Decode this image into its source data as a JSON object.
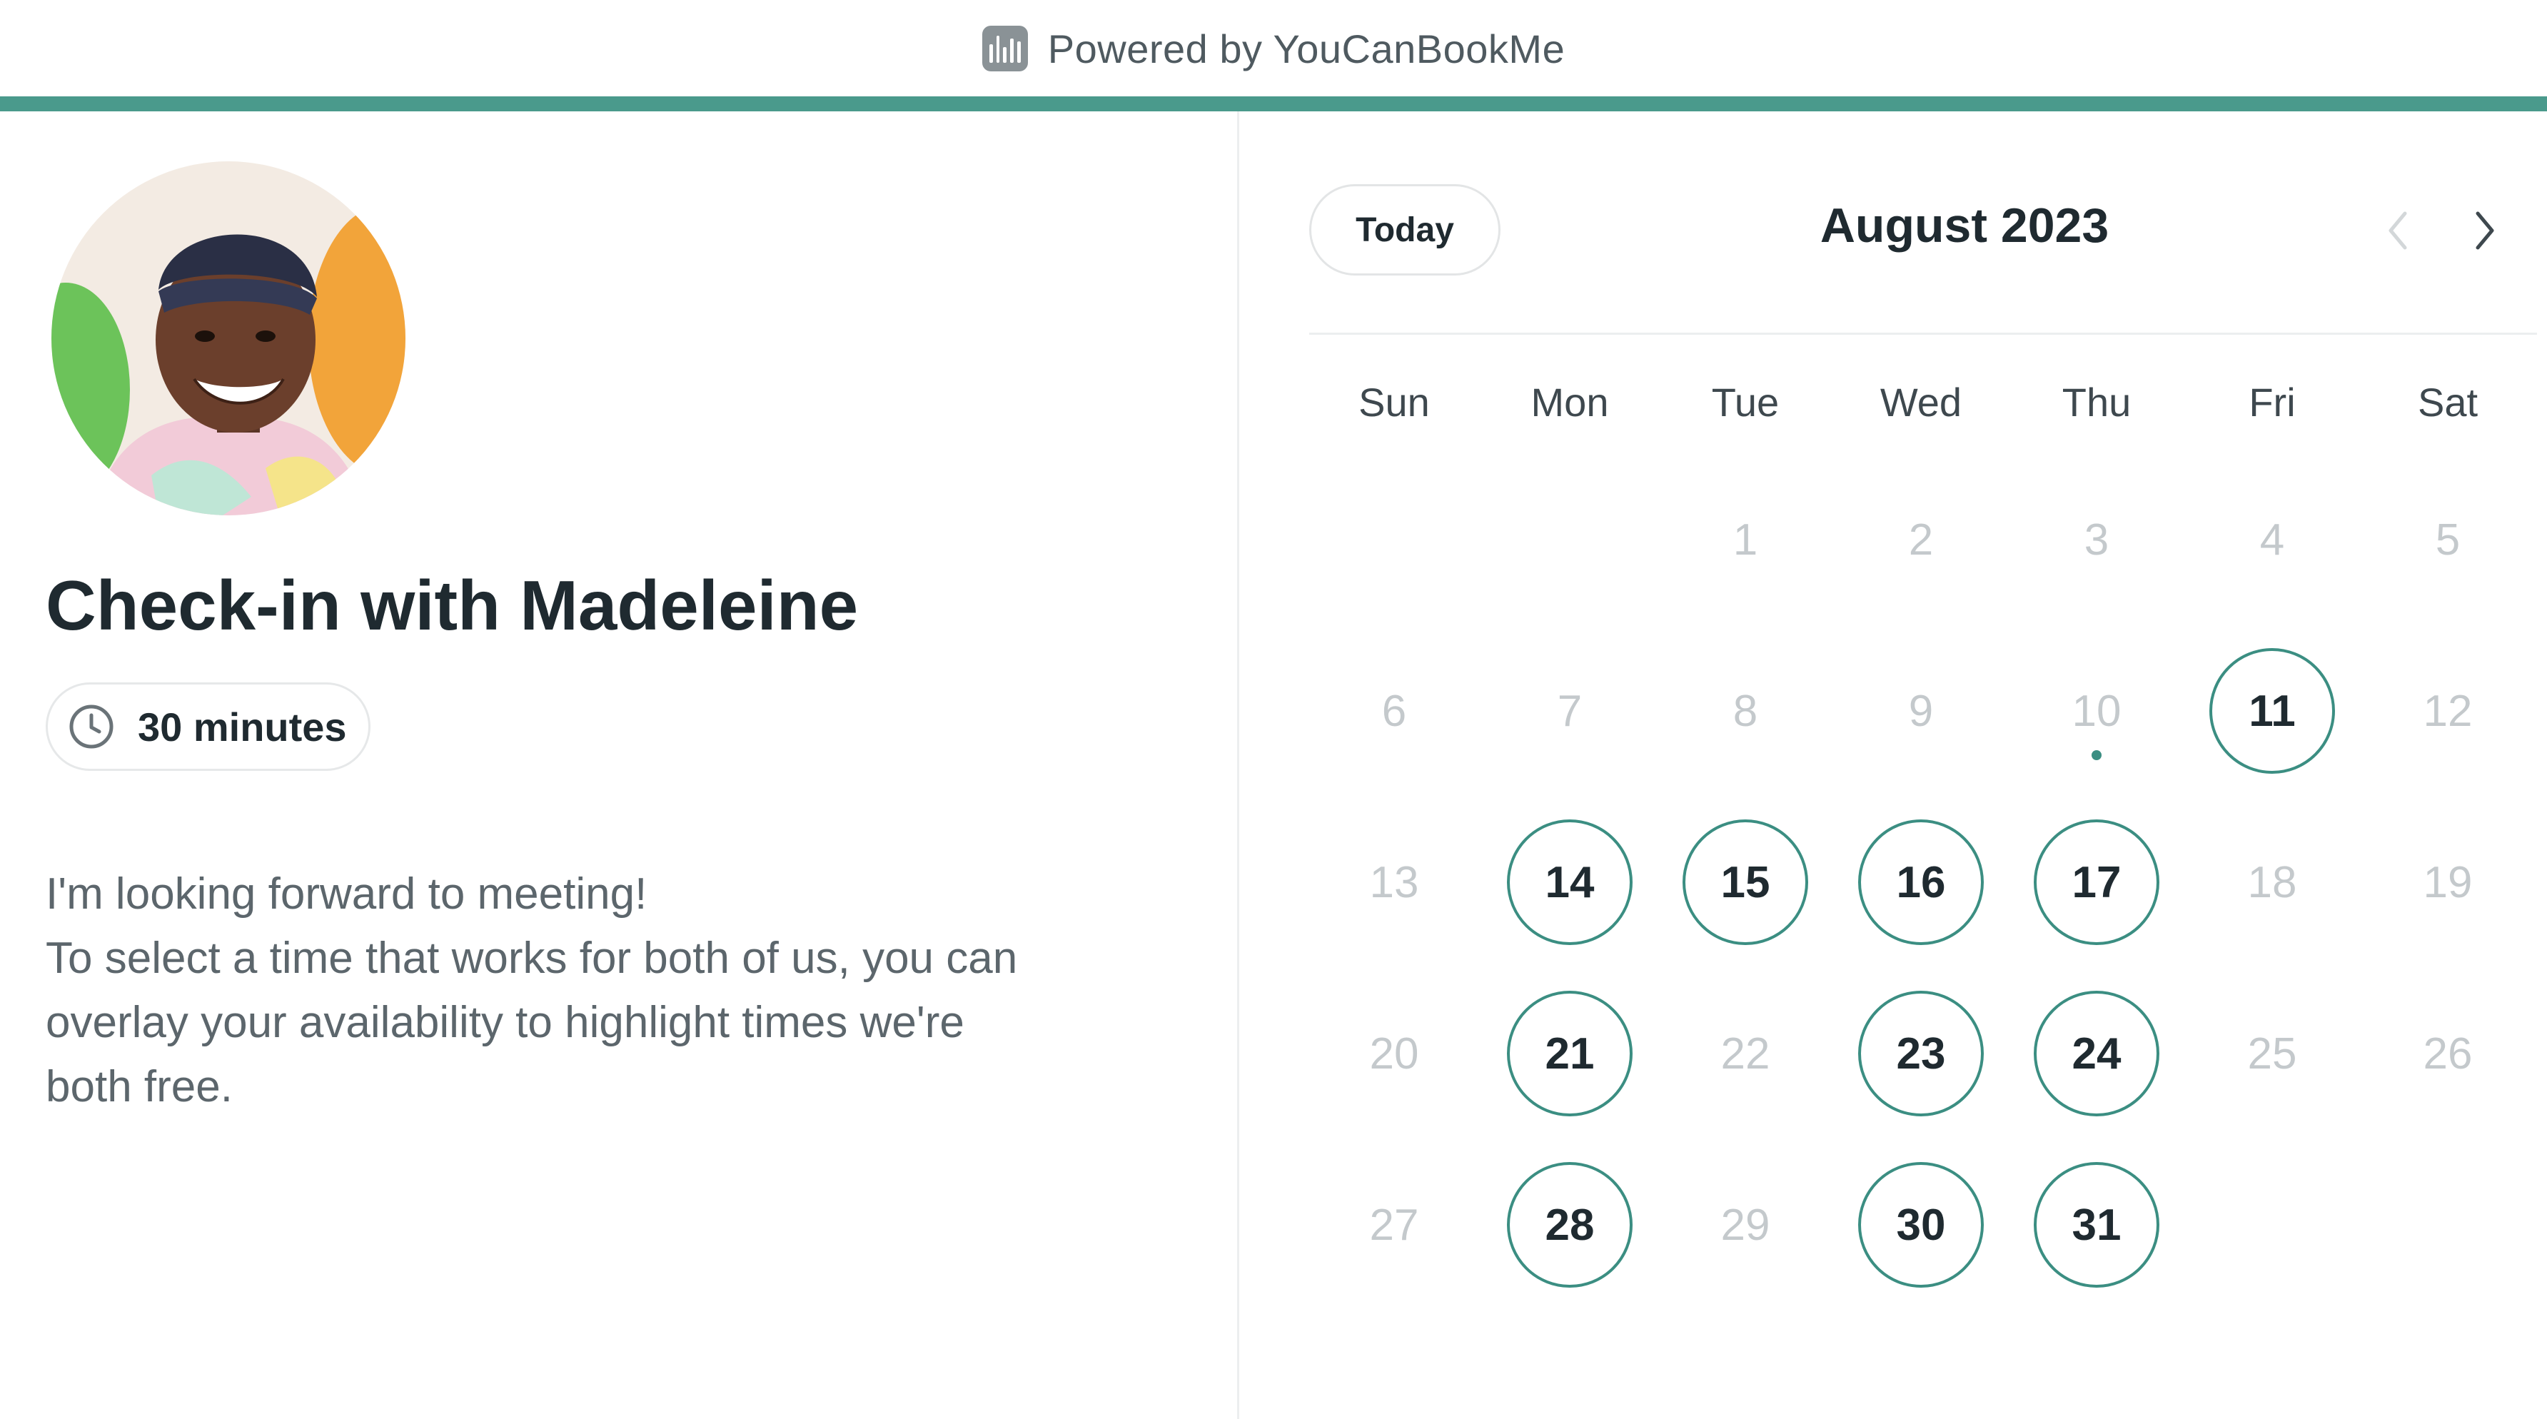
{
  "colors": {
    "accent": "#4a9a8c",
    "available_border": "#3b8e82",
    "today_dot": "#3b8e82"
  },
  "header": {
    "brand_text": "Powered by YouCanBookMe",
    "brand_icon": "youcanbookme-logo-icon"
  },
  "event": {
    "title": "Check-in with Madeleine",
    "duration": "30 minutes",
    "duration_icon": "clock-icon",
    "description_lines": [
      "I'm looking forward to meeting!",
      "To select a time that works for both of us, you can",
      "overlay your availability to highlight times we're",
      "both free."
    ]
  },
  "calendar": {
    "today_label": "Today",
    "month_label": "August 2023",
    "prev_icon": "chevron-left-icon",
    "next_icon": "chevron-right-icon",
    "weekdays": [
      "Sun",
      "Mon",
      "Tue",
      "Wed",
      "Thu",
      "Fri",
      "Sat"
    ],
    "first_weekday_index": 2,
    "days_in_month": 31,
    "today": 10,
    "available_days": [
      11,
      14,
      15,
      16,
      17,
      21,
      23,
      24,
      28,
      30,
      31
    ]
  }
}
